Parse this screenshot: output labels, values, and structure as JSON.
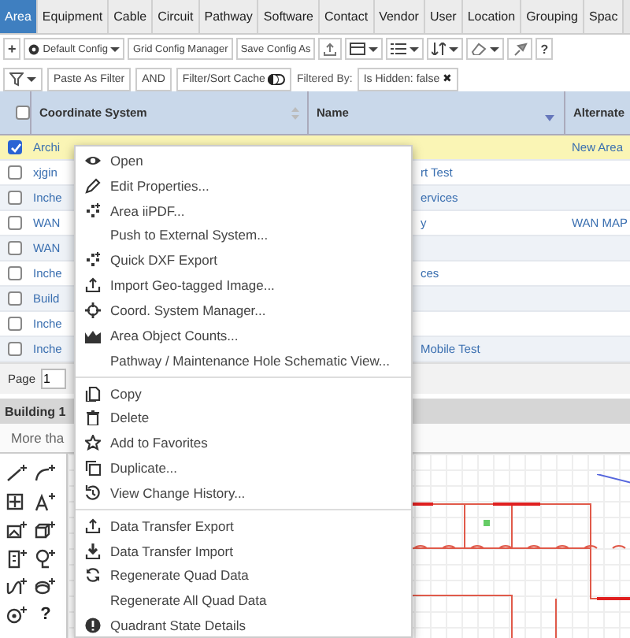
{
  "tabs": [
    {
      "label": "Area",
      "selected": true
    },
    {
      "label": "Equipment",
      "selected": false
    },
    {
      "label": "Cable",
      "selected": false
    },
    {
      "label": "Circuit",
      "selected": false
    },
    {
      "label": "Pathway",
      "selected": false
    },
    {
      "label": "Software",
      "selected": false
    },
    {
      "label": "Contact",
      "selected": false
    },
    {
      "label": "Vendor",
      "selected": false
    },
    {
      "label": "User",
      "selected": false
    },
    {
      "label": "Location",
      "selected": false
    },
    {
      "label": "Grouping",
      "selected": false
    },
    {
      "label": "Spac",
      "selected": false
    }
  ],
  "toolbar": {
    "add": "+",
    "config": "Default Config",
    "buttons": [
      "Grid Config Manager",
      "Save Config As"
    ],
    "help": "?"
  },
  "filter_bar": {
    "paste": "Paste As Filter",
    "and": "AND",
    "cache": {
      "label": "Filter/Sort Cache",
      "on": true
    },
    "filtered_by": "Filtered By:",
    "chip": "Is Hidden: false",
    "chip_remove": "✖"
  },
  "grid": {
    "select_all": {
      "checked": false
    },
    "columns": [
      "Coordinate System",
      "Name",
      "Alternate"
    ],
    "rows": [
      {
        "checked": true,
        "selected": true,
        "coordinate_system": "Archi",
        "alternate_name": "New Area"
      },
      {
        "checked": false,
        "selected": false,
        "coordinate_system": "xjgin",
        "name": "rt Test"
      },
      {
        "checked": false,
        "selected": false,
        "coordinate_system": "Inche",
        "name": "ervices"
      },
      {
        "checked": false,
        "selected": false,
        "coordinate_system": "WAN",
        "name": "y",
        "alternate_name": "WAN MAP"
      },
      {
        "checked": false,
        "selected": false,
        "coordinate_system": "WAN"
      },
      {
        "checked": false,
        "selected": false,
        "coordinate_system": "Inche",
        "name": "ces"
      },
      {
        "checked": false,
        "selected": false,
        "coordinate_system": "Build"
      },
      {
        "checked": false,
        "selected": false,
        "coordinate_system": "Inche"
      },
      {
        "checked": false,
        "selected": false,
        "coordinate_system": "Inche",
        "name": "Mobile Test"
      }
    ]
  },
  "pager": {
    "label": "Page",
    "value": "1"
  },
  "panel": {
    "title": "Building 1",
    "field": "More tha",
    "help": "?"
  },
  "context_menu": {
    "sections": [
      [
        {
          "label": "Open"
        },
        {
          "label": "Edit Properties..."
        },
        {
          "label": "Area iiPDF..."
        },
        {
          "label": "Push to External System..."
        },
        {
          "label": "Quick DXF Export"
        },
        {
          "label": "Import Geo-tagged Image..."
        },
        {
          "label": "Coord. System Manager..."
        },
        {
          "label": "Area Object Counts..."
        },
        {
          "label": "Pathway / Maintenance Hole Schematic View..."
        }
      ],
      [
        {
          "label": "Copy"
        },
        {
          "label": "Delete"
        },
        {
          "label": "Add to Favorites"
        },
        {
          "label": "Duplicate..."
        },
        {
          "label": "View Change History..."
        }
      ],
      [
        {
          "label": "Data Transfer Export"
        },
        {
          "label": "Data Transfer Import"
        },
        {
          "label": "Regenerate Quad Data"
        },
        {
          "label": "Regenerate All Quad Data"
        },
        {
          "label": "Quadrant State Details"
        }
      ]
    ]
  }
}
